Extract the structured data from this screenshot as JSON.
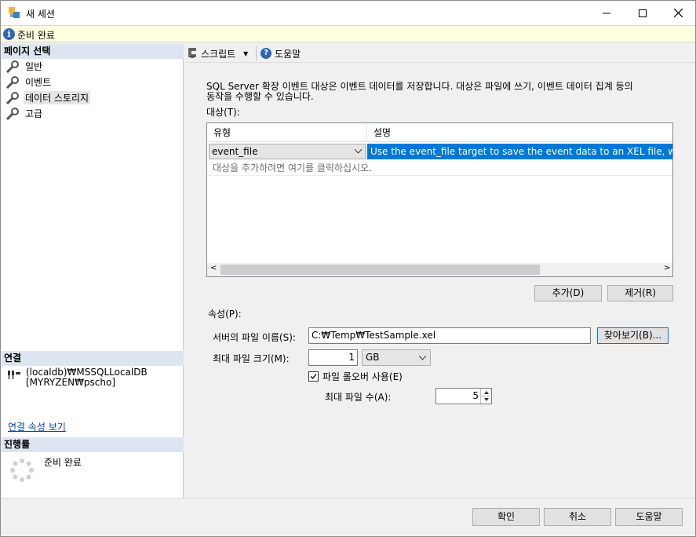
{
  "window": {
    "title": "새 세션",
    "minimize_glyph": "—",
    "maximize_glyph": "☐",
    "close_glyph": "✕"
  },
  "status": {
    "icon": "info-icon",
    "text": "준비 완료"
  },
  "left_pane": {
    "page_select_header": "페이지 선택",
    "pages": [
      {
        "label": "일반",
        "icon": "wrench-icon",
        "selected": false
      },
      {
        "label": "이벤트",
        "icon": "wrench-icon",
        "selected": false
      },
      {
        "label": "데이터 스토리지",
        "icon": "wrench-icon",
        "selected": true
      },
      {
        "label": "고급",
        "icon": "wrench-icon",
        "selected": false
      }
    ],
    "connection_header": "연결",
    "connection_line1": "(localdb)₩MSSQLLocalDB",
    "connection_line2": "[MYRYZEN₩pscho]",
    "connection_link": "연결 속성 보기",
    "progress_header": "진행률",
    "progress_text": "준비 완료"
  },
  "toolbar": {
    "script_label": "스크립트",
    "help_label": "도움말"
  },
  "main": {
    "description_line1": "SQL Server 확장 이벤트 대상은 이벤트 데이터를 저장합니다. 대상은 파일에 쓰기, 이벤트 데이터 집계 등의",
    "description_line2": "동작을 수행할 수 있습니다.",
    "targets_label": "대상(T):",
    "grid": {
      "col_type": "유형",
      "col_desc": "설명",
      "row_type": "event_file",
      "row_desc": "Use the event_file target to save the event data to an XEL file, which",
      "add_hint": "대상을 추가하려면 여기를 클릭하십시오."
    },
    "add_button": "추가(D)",
    "remove_button": "제거(R)",
    "properties_label": "속성(P):",
    "server_file_label": "서버의 파일 이름(S):",
    "server_file_value": "C:₩Temp₩TestSample.xel",
    "browse_button": "찾아보기(B)...",
    "max_size_label": "최대 파일 크기(M):",
    "max_size_value": "1",
    "size_unit": "GB",
    "rollover_label": "파일 롤오버 사용(E)",
    "rollover_checked": true,
    "max_files_label": "최대 파일 수(A):",
    "max_files_value": "5"
  },
  "footer": {
    "ok_button": "확인",
    "cancel_button": "취소",
    "help_button": "도움말"
  }
}
